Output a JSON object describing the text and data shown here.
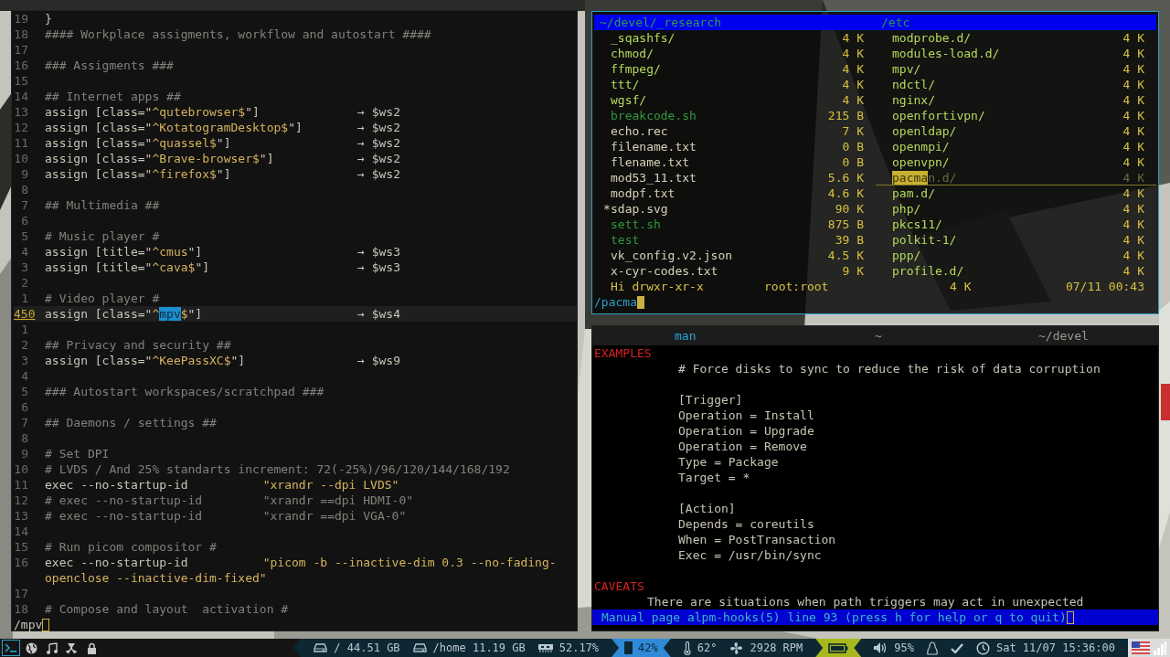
{
  "editor": {
    "focused": false,
    "lines": [
      {
        "number": "19",
        "current": false,
        "parts": [
          {
            "kind": "plain",
            "text": "}"
          }
        ]
      },
      {
        "number": "18",
        "current": false,
        "parts": [
          {
            "kind": "comment",
            "text": "#### Workplace assigments, workflow and autostart ####"
          }
        ]
      },
      {
        "number": "17",
        "current": false
      },
      {
        "number": "16",
        "current": false,
        "parts": [
          {
            "kind": "comment",
            "text": "### Assigments ###"
          }
        ]
      },
      {
        "number": "15",
        "current": false
      },
      {
        "number": "14",
        "current": false,
        "parts": [
          {
            "kind": "comment",
            "text": "## Internet apps ##"
          }
        ]
      },
      {
        "number": "13",
        "current": false,
        "parts": [
          {
            "kind": "plain",
            "text": "assign [class=\""
          },
          {
            "kind": "string",
            "text": "^qutebrowser$"
          },
          {
            "kind": "plain",
            "text": "\"]"
          }
        ],
        "target": "→ $ws2"
      },
      {
        "number": "12",
        "current": false,
        "parts": [
          {
            "kind": "plain",
            "text": "assign [class=\""
          },
          {
            "kind": "string",
            "text": "^KotatogramDesktop$"
          },
          {
            "kind": "plain",
            "text": "\"]"
          }
        ],
        "target": "→ $ws2"
      },
      {
        "number": "11",
        "current": false,
        "parts": [
          {
            "kind": "plain",
            "text": "assign [class=\""
          },
          {
            "kind": "string",
            "text": "^quassel$"
          },
          {
            "kind": "plain",
            "text": "\"]"
          }
        ],
        "target": "→ $ws2"
      },
      {
        "number": "10",
        "current": false,
        "parts": [
          {
            "kind": "plain",
            "text": "assign [class=\""
          },
          {
            "kind": "string",
            "text": "^Brave-browser$"
          },
          {
            "kind": "plain",
            "text": "\"]"
          }
        ],
        "target": "→ $ws2"
      },
      {
        "number": "9",
        "current": false,
        "parts": [
          {
            "kind": "plain",
            "text": "assign [class=\""
          },
          {
            "kind": "string",
            "text": "^firefox$"
          },
          {
            "kind": "plain",
            "text": "\"]"
          }
        ],
        "target": "→ $ws2"
      },
      {
        "number": "8",
        "current": false
      },
      {
        "number": "7",
        "current": false,
        "parts": [
          {
            "kind": "comment",
            "text": "## Multimedia ##"
          }
        ]
      },
      {
        "number": "6",
        "current": false
      },
      {
        "number": "5",
        "current": false,
        "parts": [
          {
            "kind": "comment",
            "text": "# Music player #"
          }
        ]
      },
      {
        "number": "4",
        "current": false,
        "parts": [
          {
            "kind": "plain",
            "text": "assign [title=\""
          },
          {
            "kind": "string",
            "text": "^cmus"
          },
          {
            "kind": "plain",
            "text": "\"]"
          }
        ],
        "target": "→ $ws3"
      },
      {
        "number": "3",
        "current": false,
        "parts": [
          {
            "kind": "plain",
            "text": "assign [title=\""
          },
          {
            "kind": "string",
            "text": "^cava$"
          },
          {
            "kind": "plain",
            "text": "\"]"
          }
        ],
        "target": "→ $ws3"
      },
      {
        "number": "2",
        "current": false
      },
      {
        "number": "1",
        "current": false,
        "parts": [
          {
            "kind": "comment",
            "text": "# Video player #"
          }
        ]
      },
      {
        "number": "450",
        "current": true,
        "parts": [
          {
            "kind": "plain",
            "text": "assign [class=\""
          },
          {
            "kind": "string",
            "text": "^"
          },
          {
            "kind": "match",
            "text": "mpv"
          },
          {
            "kind": "string",
            "text": "$"
          },
          {
            "kind": "plain",
            "text": "\"]"
          }
        ],
        "target": "→ $ws4"
      },
      {
        "number": "1",
        "current": false
      },
      {
        "number": "2",
        "current": false,
        "parts": [
          {
            "kind": "comment",
            "text": "## Privacy and security ##"
          }
        ]
      },
      {
        "number": "3",
        "current": false,
        "parts": [
          {
            "kind": "plain",
            "text": "assign [class=\""
          },
          {
            "kind": "string",
            "text": "^KeePassXC$"
          },
          {
            "kind": "plain",
            "text": "\"]"
          }
        ],
        "target": "→ $ws9"
      },
      {
        "number": "4",
        "current": false
      },
      {
        "number": "5",
        "current": false,
        "parts": [
          {
            "kind": "comment",
            "text": "### Autostart workspaces/scratchpad ###"
          }
        ]
      },
      {
        "number": "6",
        "current": false
      },
      {
        "number": "7",
        "current": false,
        "parts": [
          {
            "kind": "comment",
            "text": "## Daemons / settings ##"
          }
        ]
      },
      {
        "number": "8",
        "current": false
      },
      {
        "number": "9",
        "current": false,
        "parts": [
          {
            "kind": "comment",
            "text": "# Set DPI"
          }
        ]
      },
      {
        "number": "10",
        "current": false,
        "parts": [
          {
            "kind": "comment",
            "text": "# LVDS / And 25% standarts increment: 72(-25%)/96/120/144/168/192"
          }
        ]
      },
      {
        "number": "11",
        "current": false,
        "parts": [
          {
            "kind": "plain",
            "text": "exec --no-startup-id"
          }
        ],
        "value": {
          "kind": "string",
          "text": "\"xrandr --dpi LVDS\""
        }
      },
      {
        "number": "12",
        "current": false,
        "parts": [
          {
            "kind": "comment",
            "text": "# exec --no-startup-id"
          }
        ],
        "value": {
          "kind": "comment",
          "text": "\"xrandr ==dpi HDMI-0\""
        }
      },
      {
        "number": "13",
        "current": false,
        "parts": [
          {
            "kind": "comment",
            "text": "# exec --no-startup-id"
          }
        ],
        "value": {
          "kind": "comment",
          "text": "\"xrandr ==dpi VGA-0\""
        }
      },
      {
        "number": "14",
        "current": false
      },
      {
        "number": "15",
        "current": false,
        "parts": [
          {
            "kind": "comment",
            "text": "# Run picom compositor #"
          }
        ]
      },
      {
        "number": "16",
        "current": false,
        "parts": [
          {
            "kind": "plain",
            "text": "exec --no-startup-id"
          }
        ],
        "value": {
          "kind": "string",
          "text": "\"picom -b --inactive-dim 0.3 --no-fading-"
        },
        "continuation": "openclose --inactive-dim-fixed\""
      },
      {
        "number": "17",
        "current": false
      },
      {
        "number": "18",
        "current": false,
        "parts": [
          {
            "kind": "comment",
            "text": "# Compose and layout  activation #"
          }
        ]
      }
    ],
    "command": "/mpv"
  },
  "file_manager": {
    "focused": true,
    "left_panel": {
      "path": "~/devel/_research",
      "items": [
        {
          "name": "_sqashfs/",
          "size": "4 K",
          "kind": "dir"
        },
        {
          "name": "chmod/",
          "size": "4 K",
          "kind": "dir"
        },
        {
          "name": "ffmpeg/",
          "size": "4 K",
          "kind": "dir"
        },
        {
          "name": "ttt/",
          "size": "4 K",
          "kind": "dir"
        },
        {
          "name": "wgsf/",
          "size": "4 K",
          "kind": "dir"
        },
        {
          "name": "breakcode.sh",
          "size": "215 B",
          "kind": "exec"
        },
        {
          "name": "echo.rec",
          "size": "7 K",
          "kind": "file"
        },
        {
          "name": "filename.txt",
          "size": "0 B",
          "kind": "file"
        },
        {
          "name": "flename.txt",
          "size": "0 B",
          "kind": "file"
        },
        {
          "name": "mod53_11.txt",
          "size": "5.6 K",
          "kind": "file"
        },
        {
          "name": "modpf.txt",
          "size": "4.6 K",
          "kind": "file"
        },
        {
          "tag": "*",
          "name": "sdap.svg",
          "size": "90 K",
          "kind": "file"
        },
        {
          "name": "sett.sh",
          "size": "875 B",
          "kind": "exec"
        },
        {
          "name": "test",
          "size": "39 B",
          "kind": "exec"
        },
        {
          "name": "vk_config.v2.json",
          "size": "4.5 K",
          "kind": "file"
        },
        {
          "name": "x-cyr-codes.txt",
          "size": "9 K",
          "kind": "file"
        }
      ]
    },
    "right_panel": {
      "path": "/etc",
      "items": [
        {
          "name": "modprobe.d/",
          "size": "4 K",
          "kind": "dir",
          "selected": false
        },
        {
          "name": "modules-load.d/",
          "size": "4 K",
          "kind": "dir",
          "selected": false
        },
        {
          "name": "mpv/",
          "size": "4 K",
          "kind": "dir",
          "selected": false
        },
        {
          "name": "ndctl/",
          "size": "4 K",
          "kind": "dir",
          "selected": false
        },
        {
          "name": "nginx/",
          "size": "4 K",
          "kind": "dir",
          "selected": false
        },
        {
          "name": "openfortivpn/",
          "size": "4 K",
          "kind": "dir",
          "selected": false
        },
        {
          "name": "openldap/",
          "size": "4 K",
          "kind": "dir",
          "selected": false
        },
        {
          "name": "openmpi/",
          "size": "4 K",
          "kind": "dir",
          "selected": false
        },
        {
          "name": "openvpn/",
          "size": "4 K",
          "kind": "dir",
          "selected": false
        },
        {
          "match": "pacma",
          "name": "n.d/",
          "size": "4 K",
          "kind": "dir",
          "selected": true
        },
        {
          "name": "pam.d/",
          "size": "4 K",
          "kind": "dir",
          "selected": false
        },
        {
          "name": "php/",
          "size": "4 K",
          "kind": "dir",
          "selected": false
        },
        {
          "name": "pkcs11/",
          "size": "4 K",
          "kind": "dir",
          "selected": false
        },
        {
          "name": "polkit-1/",
          "size": "4 K",
          "kind": "dir",
          "selected": false
        },
        {
          "name": "ppp/",
          "size": "4 K",
          "kind": "dir",
          "selected": false
        },
        {
          "name": "profile.d/",
          "size": "4 K",
          "kind": "dir",
          "selected": false
        }
      ]
    },
    "status": {
      "permissions": "Hi drwxr-xr-x",
      "owner": "root:root",
      "size": "4 K",
      "modified": "07/11 00:43"
    },
    "command": "/pacma"
  },
  "man_window": {
    "focused": false,
    "title_bar": {
      "left": "man",
      "center": "~",
      "right": "~/devel"
    },
    "lines": [
      {
        "kind": "heading",
        "text": "EXAMPLES"
      },
      {
        "kind": "code",
        "text": "# Force disks to sync to reduce the risk of data corruption"
      },
      {
        "kind": "blank"
      },
      {
        "kind": "code",
        "text": "[Trigger]"
      },
      {
        "kind": "code",
        "text": "Operation = Install"
      },
      {
        "kind": "code",
        "text": "Operation = Upgrade"
      },
      {
        "kind": "code",
        "text": "Operation = Remove"
      },
      {
        "kind": "code",
        "text": "Type = Package"
      },
      {
        "kind": "code",
        "text": "Target = *"
      },
      {
        "kind": "blank"
      },
      {
        "kind": "code",
        "text": "[Action]"
      },
      {
        "kind": "code",
        "text": "Depends = coreutils"
      },
      {
        "kind": "code",
        "text": "When = PostTransaction"
      },
      {
        "kind": "code",
        "text": "Exec = /usr/bin/sync"
      },
      {
        "kind": "blank"
      },
      {
        "kind": "heading",
        "text": "CAVEATS"
      },
      {
        "kind": "para",
        "text": "There are situations when path triggers may act in unexpected"
      }
    ],
    "status": "Manual page alpm-hooks(5) line 93 (press h for help or q to quit)"
  },
  "status_bar": {
    "workspaces": [
      {
        "kind": "terminal",
        "selected": true
      },
      {
        "kind": "globe",
        "selected": false
      },
      {
        "kind": "music",
        "selected": false
      },
      {
        "kind": "radiation",
        "selected": false
      },
      {
        "kind": "lock",
        "selected": false
      }
    ],
    "modules": [
      {
        "kind": "disk",
        "text": "/ 44.51 GB"
      },
      {
        "kind": "disk",
        "text": "/home 11.19 GB"
      },
      {
        "kind": "memory",
        "text": "52.17%"
      },
      {
        "kind": "phone",
        "text": "42%",
        "color": "#2f8ad8"
      },
      {
        "kind": "temperature",
        "text": "62°"
      },
      {
        "kind": "fan",
        "text": "2928 RPM"
      },
      {
        "kind": "battery",
        "color": "#a8b81c"
      },
      {
        "kind": "volume",
        "text": "95%"
      },
      {
        "kind": "penguin"
      },
      {
        "kind": "check"
      },
      {
        "kind": "clock",
        "text": "Sat 11/07 15:36:00"
      }
    ],
    "tray": [
      {
        "kind": "flag"
      },
      {
        "kind": "signal"
      }
    ]
  }
}
